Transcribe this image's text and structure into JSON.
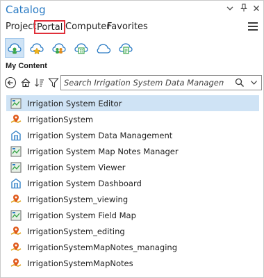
{
  "window": {
    "title": "Catalog",
    "controls": [
      "chevron-down-icon",
      "pin-icon",
      "close-icon"
    ]
  },
  "tabs": [
    {
      "label": "Project",
      "active": false
    },
    {
      "label": "Portal",
      "active": true
    },
    {
      "label": "Computer",
      "active": false
    },
    {
      "label": "Favorites",
      "active": false
    }
  ],
  "portal_icons": [
    {
      "name": "my-content-icon",
      "selected": true
    },
    {
      "name": "my-favorites-icon",
      "selected": false
    },
    {
      "name": "my-groups-icon",
      "selected": false
    },
    {
      "name": "my-organization-icon",
      "selected": false
    },
    {
      "name": "arcgis-online-icon",
      "selected": false
    },
    {
      "name": "living-atlas-icon",
      "selected": false
    }
  ],
  "section": {
    "label": "My Content"
  },
  "search": {
    "placeholder": "Search Irrigation System Data Management",
    "value": ""
  },
  "colors": {
    "accent_blue": "#2a7bc4",
    "selected_bg": "#cfe3f5",
    "active_tab_border": "#e0303a"
  },
  "items": [
    {
      "label": "Irrigation System Editor",
      "icon": "web-app-icon",
      "selected": true
    },
    {
      "label": "IrrigationSystem",
      "icon": "web-map-icon",
      "selected": false
    },
    {
      "label": "Irrigation System Data Management",
      "icon": "experience-icon",
      "selected": false
    },
    {
      "label": "Irrigation System Map Notes Manager",
      "icon": "web-app-icon",
      "selected": false
    },
    {
      "label": "Irrigation System Viewer",
      "icon": "web-app-icon",
      "selected": false
    },
    {
      "label": "Irrigation System Dashboard",
      "icon": "experience-icon",
      "selected": false
    },
    {
      "label": "IrrigationSystem_viewing",
      "icon": "web-map-icon",
      "selected": false
    },
    {
      "label": "Irrigation System Field Map",
      "icon": "web-app-icon",
      "selected": false
    },
    {
      "label": "IrrigationSystem_editing",
      "icon": "web-map-icon",
      "selected": false
    },
    {
      "label": "IrrigationSystemMapNotes_managing",
      "icon": "web-map-icon",
      "selected": false
    },
    {
      "label": "IrrigationSystemMapNotes",
      "icon": "web-map-icon",
      "selected": false
    }
  ]
}
